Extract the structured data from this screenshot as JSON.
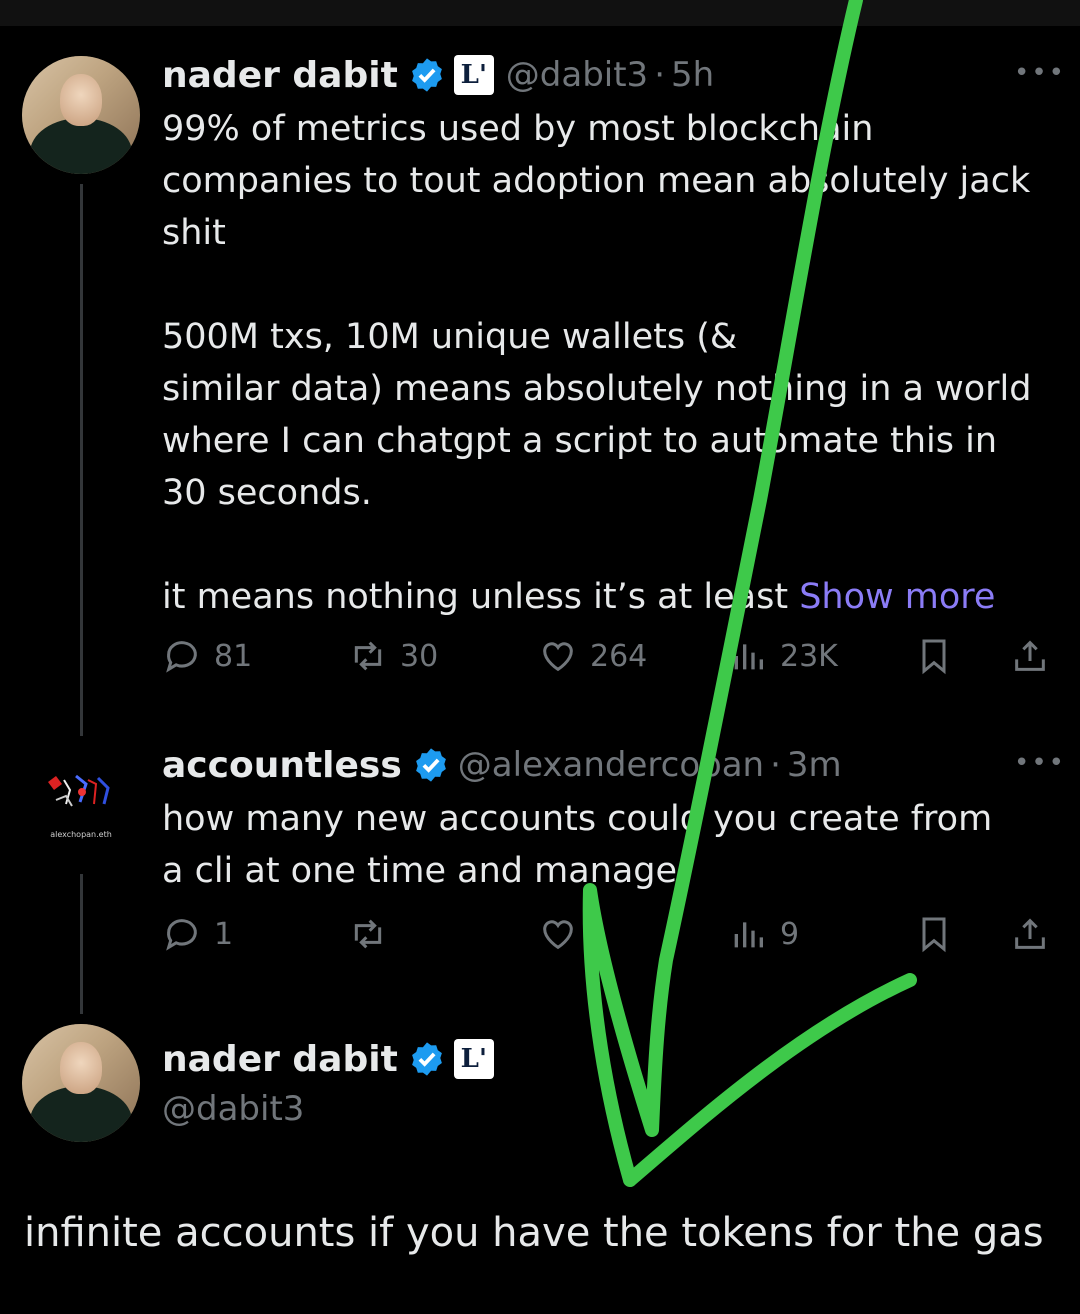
{
  "tweet1": {
    "name": "nader dabit",
    "handle": "@dabit3",
    "time": "5h",
    "affiliate_badge": "L'",
    "text_lines": [
      "99% of metrics used by most blockchain",
      "companies to tout adoption mean absolutely jack",
      "shit",
      "",
      "500M txs, 10M unique wallets (&",
      "similar data) means absolutely nothing in a world",
      "where I can chatgpt a script to automate this in",
      "30 seconds.",
      "",
      "it means nothing unless it’s at least"
    ],
    "show_more": "Show more",
    "replies": "81",
    "reposts": "30",
    "likes": "264",
    "views": "23K"
  },
  "tweet2": {
    "name": "accountless",
    "handle": "@alexandercopan",
    "time": "3m",
    "avatar_signature": "alexchopan.eth",
    "text_lines": [
      "how many new accounts could you create from",
      "a cli at one time and manage"
    ],
    "replies": "1",
    "views": "9"
  },
  "tweet3": {
    "name": "nader dabit",
    "handle": "@dabit3",
    "affiliate_badge": "L'"
  },
  "reply_text": "infinite accounts if you have the tokens for the gas",
  "colors": {
    "background": "#000000",
    "text": "#e7e9ea",
    "muted": "#71767b",
    "verified": "#1d9bf0",
    "link": "#8b7cf6",
    "scribble": "#3ec94a"
  },
  "icons": {
    "more": "more-horizontal-icon",
    "reply": "reply-icon",
    "repost": "repost-icon",
    "like": "heart-icon",
    "views": "views-icon",
    "bookmark": "bookmark-icon",
    "share": "share-icon"
  }
}
